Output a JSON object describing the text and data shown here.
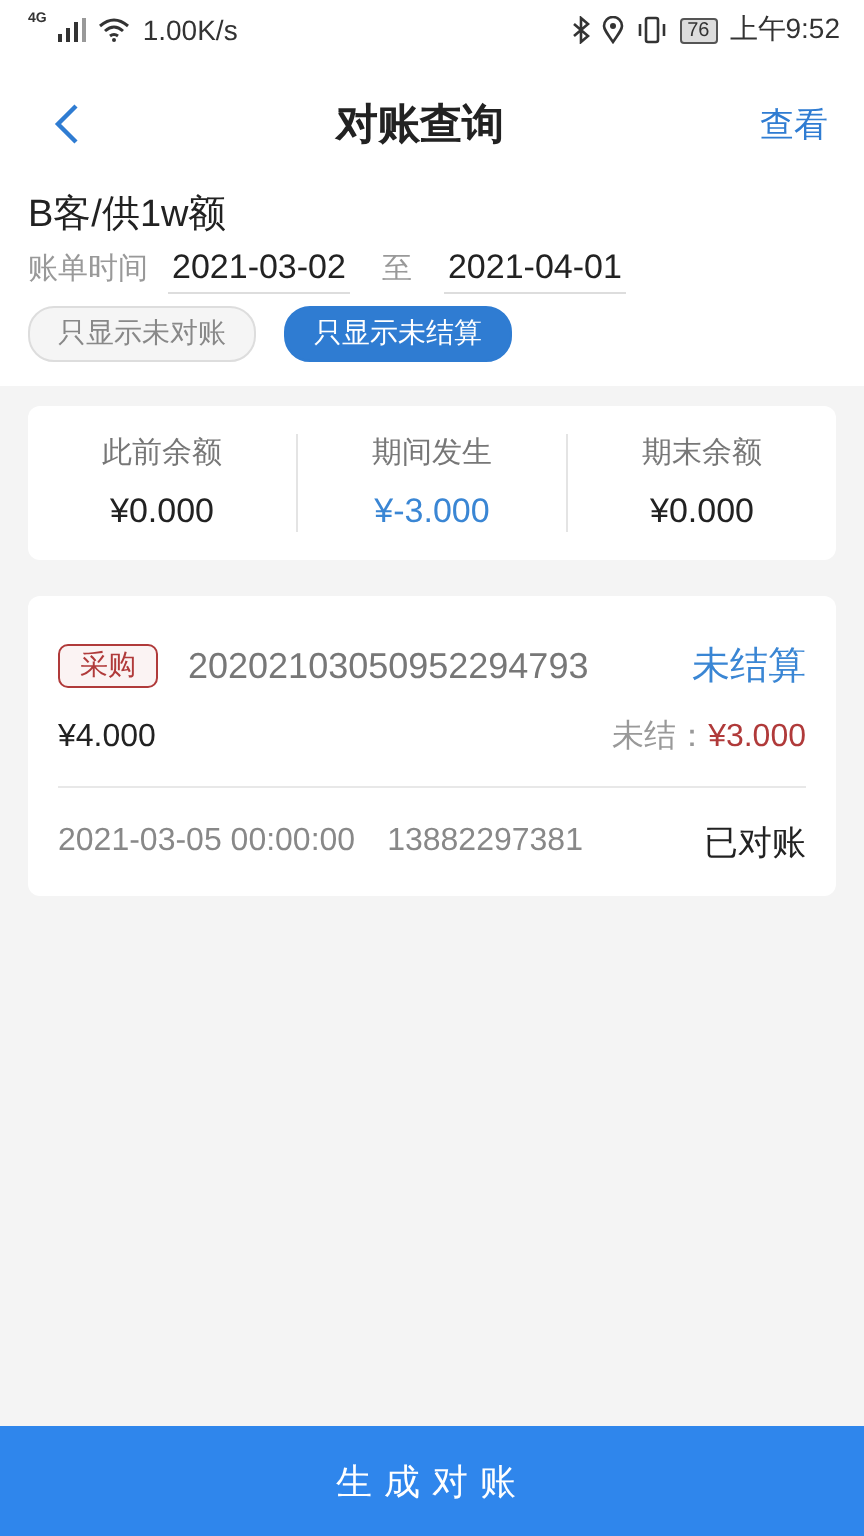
{
  "status_bar": {
    "network": "4G",
    "speed": "1.00K/s",
    "battery": "76",
    "time": "上午9:52"
  },
  "header": {
    "title": "对账查询",
    "action": "查看"
  },
  "account": {
    "name": "B客/供1w额",
    "period_label": "账单时间",
    "start_date": "2021-03-02",
    "separator": "至",
    "end_date": "2021-04-01"
  },
  "filters": [
    {
      "label": "只显示未对账",
      "selected": false
    },
    {
      "label": "只显示未结算",
      "selected": true
    }
  ],
  "summary": [
    {
      "label": "此前余额",
      "value": "¥0.000",
      "highlight": false
    },
    {
      "label": "期间发生",
      "value": "¥-3.000",
      "highlight": true
    },
    {
      "label": "期末余额",
      "value": "¥0.000",
      "highlight": false
    }
  ],
  "records": [
    {
      "tag": "采购",
      "number": "20202103050952294793",
      "status": "未结算",
      "amount": "¥4.000",
      "unsettled_label": "未结：",
      "unsettled_value": "¥3.000",
      "datetime": "2021-03-05 00:00:00",
      "phone": "13882297381",
      "reconciled": "已对账"
    }
  ],
  "footer_button": "生成对账"
}
